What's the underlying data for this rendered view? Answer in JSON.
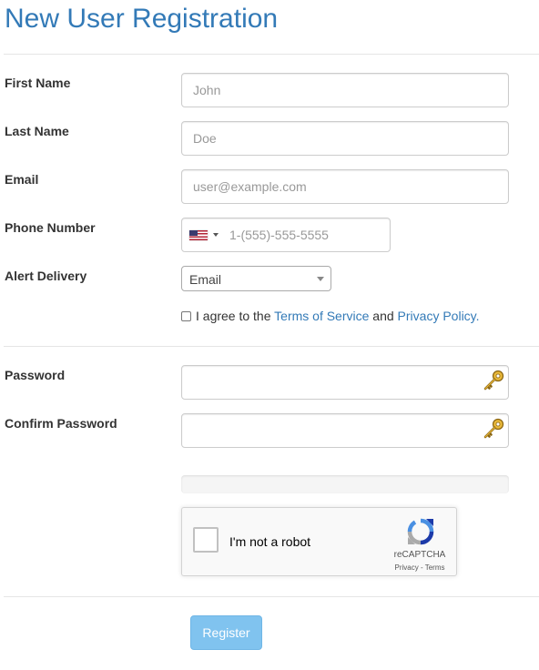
{
  "page": {
    "title": "New User Registration"
  },
  "form": {
    "first_name": {
      "label": "First Name",
      "placeholder": "John",
      "value": ""
    },
    "last_name": {
      "label": "Last Name",
      "placeholder": "Doe",
      "value": ""
    },
    "email": {
      "label": "Email",
      "placeholder": "user@example.com",
      "value": ""
    },
    "phone": {
      "label": "Phone Number",
      "placeholder": "1-(555)-555-5555",
      "value": "",
      "country_icon": "us-flag-icon"
    },
    "alert_delivery": {
      "label": "Alert Delivery",
      "selected": "Email"
    },
    "agree": {
      "prefix": "I agree to the",
      "terms_link": "Terms of Service",
      "middle": "and",
      "privacy_link": "Privacy Policy.",
      "checked": false
    },
    "password": {
      "label": "Password",
      "value": "",
      "icon": "key-icon"
    },
    "confirm_password": {
      "label": "Confirm Password",
      "value": "",
      "icon": "key-icon"
    },
    "strength": {
      "level": 0
    }
  },
  "recaptcha": {
    "label": "I'm not a robot",
    "brand": "reCAPTCHA",
    "privacy": "Privacy",
    "separator": " - ",
    "terms": "Terms",
    "checked": false
  },
  "actions": {
    "register_label": "Register"
  },
  "colors": {
    "accent": "#337ab7",
    "button": "#80c3ef"
  }
}
